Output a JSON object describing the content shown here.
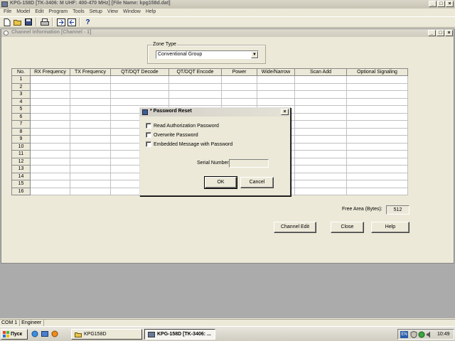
{
  "window": {
    "title": "KPG-158D [TK-3406: M UHF: 400-470 MHz] [File Name: kpg158d.dat]",
    "controls": [
      "_",
      "□",
      "×"
    ]
  },
  "menu": [
    "File",
    "Model",
    "Edit",
    "Program",
    "Tools",
    "Setup",
    "View",
    "Window",
    "Help"
  ],
  "toolbar": {
    "icons": [
      "new-file-icon",
      "open-folder-icon",
      "save-disk-icon",
      "print-icon",
      "read-radio-icon",
      "write-radio-icon",
      "help-question-icon"
    ],
    "help_glyph": "?"
  },
  "child_window": {
    "title": "Channel Information [Channel - 1]",
    "controls": [
      "_",
      "□",
      "×"
    ]
  },
  "zone": {
    "legend": "Zone Type",
    "value": "Conventional Group",
    "arrow": "▼"
  },
  "table": {
    "columns": [
      "No.",
      "RX Frequency",
      "TX Frequency",
      "QT/DQT Decode",
      "QT/DQT Encode",
      "Power",
      "Wide/Narrow",
      "Scan Add",
      "Optional Signaling"
    ],
    "rows": [
      "1",
      "2",
      "3",
      "4",
      "5",
      "6",
      "7",
      "8",
      "9",
      "10",
      "11",
      "12",
      "13",
      "14",
      "15",
      "16"
    ]
  },
  "free_area": {
    "label": "Free Area (Bytes):",
    "value": "512"
  },
  "buttons": {
    "channel_edit": "Channel Edit",
    "close": "Close",
    "help": "Help"
  },
  "dialog": {
    "title": "* Password Reset",
    "close": "×",
    "options": [
      "Read Authorization Password",
      "Overwrite Password",
      "Embedded Message with Password"
    ],
    "serial_label": "Serial Number",
    "serial_value": "",
    "ok": "OK",
    "cancel": "Cancel"
  },
  "status": [
    "COM 1",
    "Engineer"
  ],
  "taskbar": {
    "start": "Пуск",
    "tasks": [
      "KPG158D",
      "KPG-158D [TK-3406: ..."
    ],
    "lang": "EN",
    "time": "10:49"
  },
  "colors": {
    "desktop_gray": "#ababab",
    "face": "#ece9d8",
    "flag": [
      "#e2452b",
      "#4eb23e",
      "#2b6fd6",
      "#f2c20f"
    ]
  }
}
